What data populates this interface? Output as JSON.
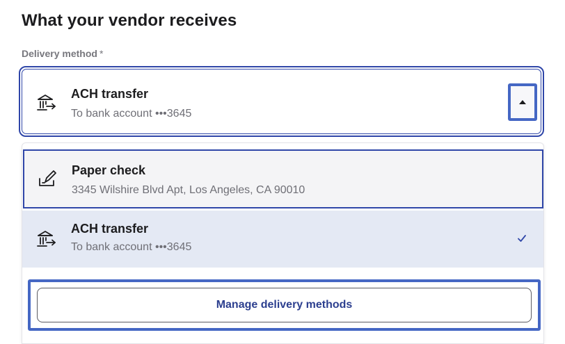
{
  "heading": "What your vendor receives",
  "delivery_field": {
    "label": "Delivery method",
    "required_mark": "*"
  },
  "selected": {
    "icon": "bank-transfer-icon",
    "title": "ACH transfer",
    "subtitle": "To bank account •••3645"
  },
  "options": [
    {
      "icon": "check-pen-icon",
      "title": "Paper check",
      "subtitle": "3345 Wilshire Blvd Apt, Los Angeles, CA 90010",
      "focused": true
    },
    {
      "icon": "bank-transfer-icon",
      "title": "ACH transfer",
      "subtitle": "To bank account •••3645",
      "selected": true
    }
  ],
  "manage_label": "Manage delivery methods",
  "colors": {
    "accent": "#2f46a8",
    "highlight": "#4567c4",
    "selected_bg": "#e4e9f4",
    "focused_bg": "#f4f4f6",
    "link_text": "#2c3f8f"
  }
}
